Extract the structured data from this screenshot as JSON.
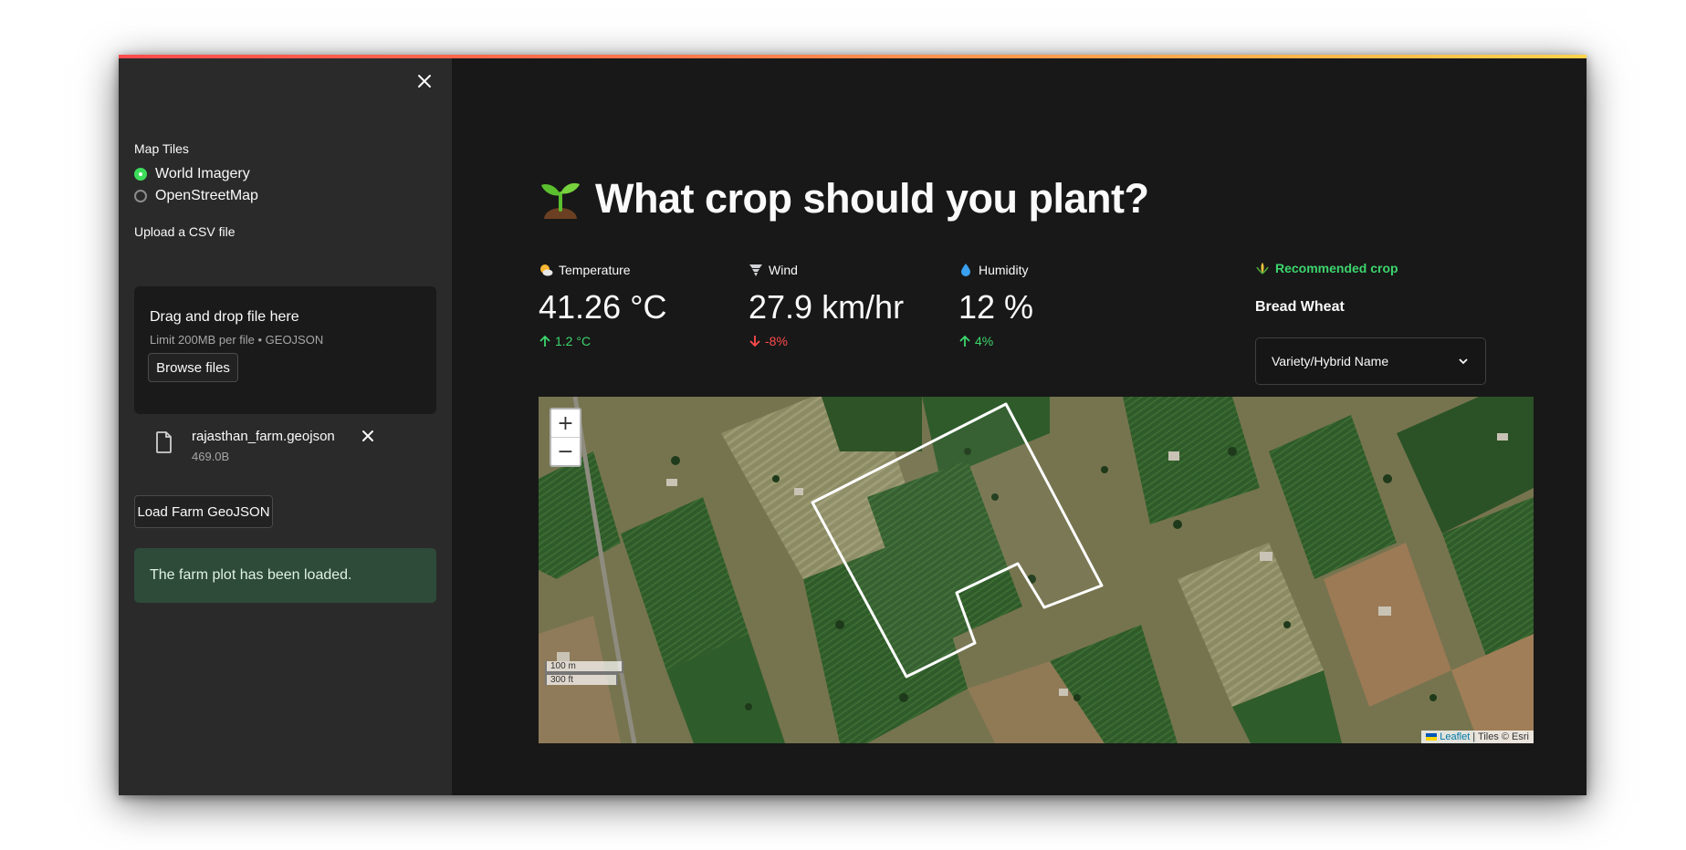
{
  "sidebar": {
    "map_tiles_label": "Map Tiles",
    "map_tiles_options": [
      {
        "label": "World Imagery",
        "selected": true
      },
      {
        "label": "OpenStreetMap",
        "selected": false
      }
    ],
    "upload_label": "Upload a CSV file",
    "uploader": {
      "drop_title": "Drag and drop file here",
      "limit_text": "Limit 200MB per file • GEOJSON",
      "browse_label": "Browse files"
    },
    "file": {
      "name": "rajasthan_farm.geojson",
      "size": "469.0B"
    },
    "load_button": "Load Farm GeoJSON",
    "success_message": "The farm plot has been loaded."
  },
  "main": {
    "title": "What crop should you plant?",
    "metrics": [
      {
        "label": "Temperature",
        "icon": "sun-cloud-icon",
        "value": "41.26 °C",
        "delta": "1.2 °C",
        "direction": "up"
      },
      {
        "label": "Wind",
        "icon": "tornado-icon",
        "value": "27.9 km/hr",
        "delta": "-8%",
        "direction": "down"
      },
      {
        "label": "Humidity",
        "icon": "droplet-icon",
        "value": "12 %",
        "delta": "4%",
        "direction": "up"
      }
    ],
    "recommended_label": "Recommended crop",
    "recommended_crop": "Bread Wheat",
    "variety_select": "Variety/Hybrid Name"
  },
  "map": {
    "zoom_in": "+",
    "zoom_out": "−",
    "scale_m": "100 m",
    "scale_ft": "300 ft",
    "attribution_link": "Leaflet",
    "attribution_text": "| Tiles © Esri"
  },
  "colors": {
    "accent_green": "#3dd56d",
    "delta_red": "#ff4b4b",
    "success_bg": "#2e4a39",
    "sidebar_bg": "#2a2a2b",
    "main_bg": "#181818"
  }
}
